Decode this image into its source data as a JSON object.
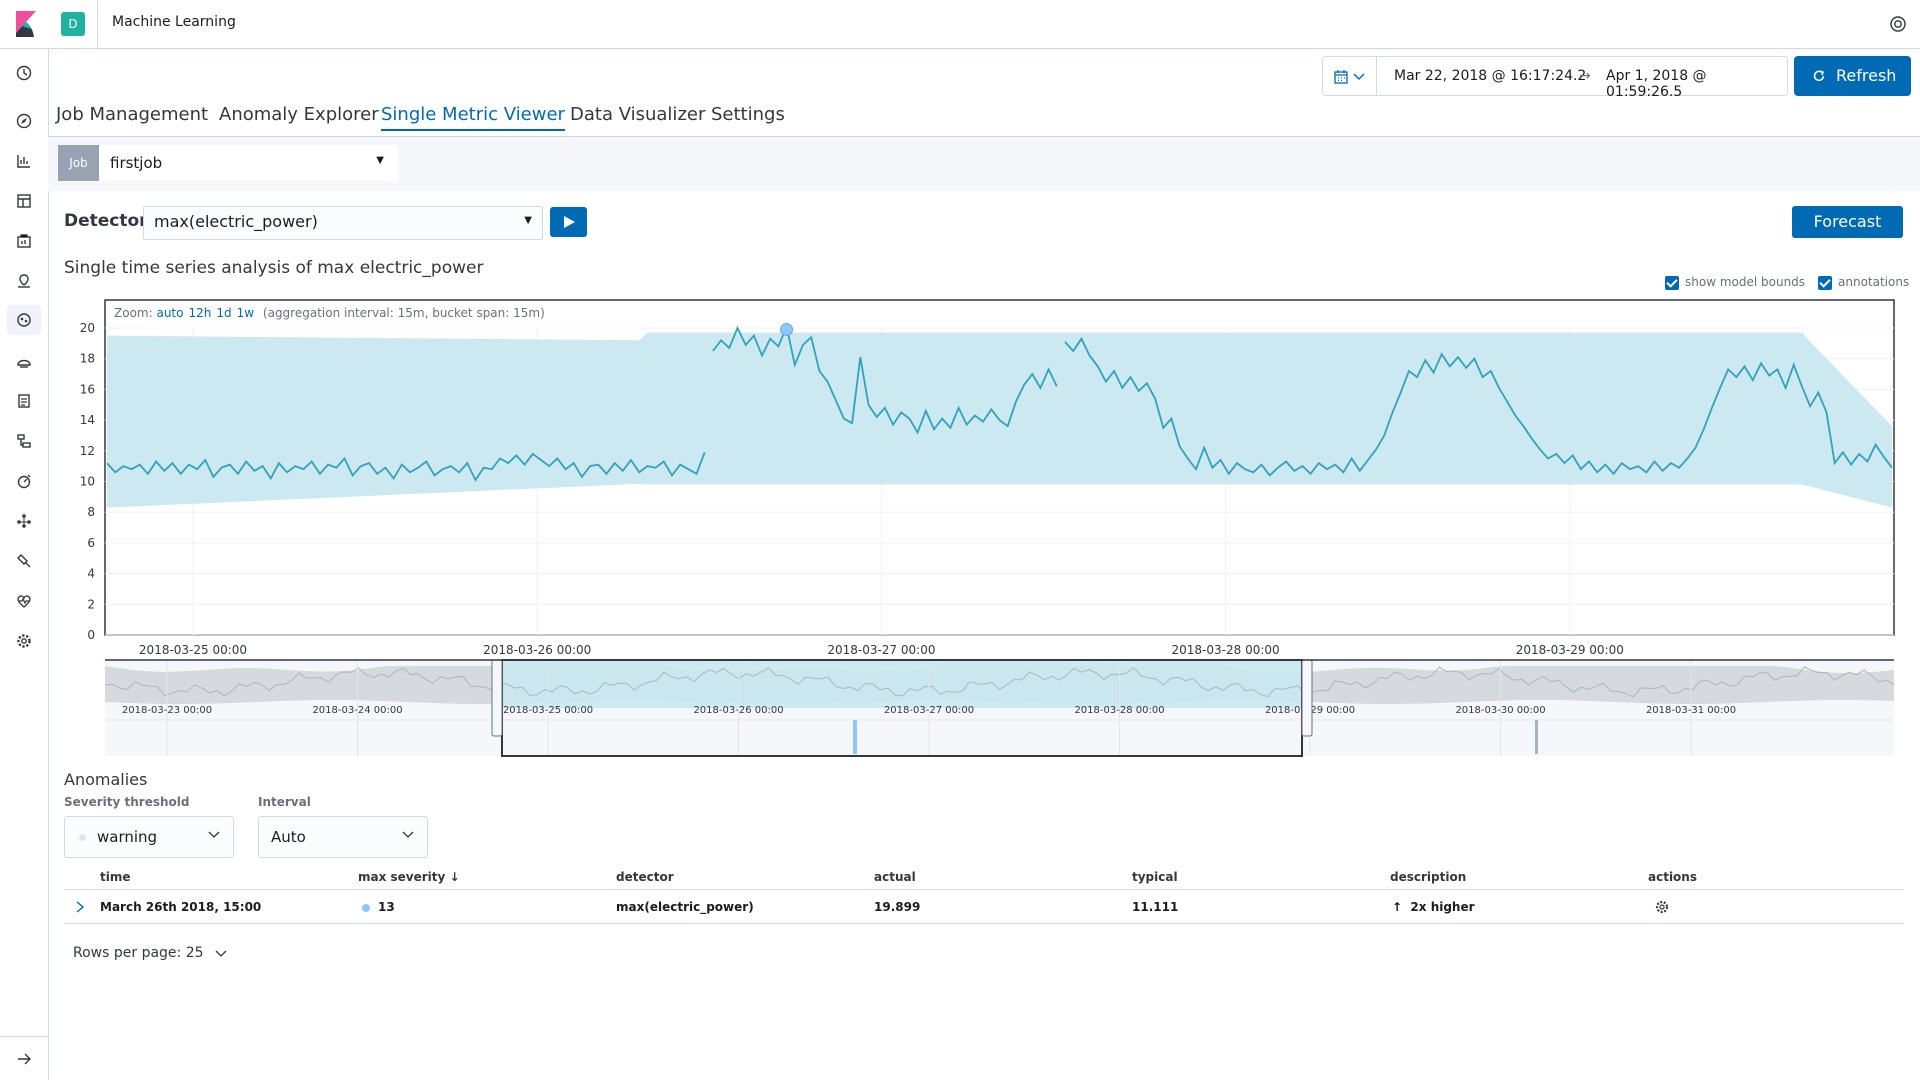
{
  "header": {
    "app_title": "Machine Learning",
    "space_initial": "D"
  },
  "time_picker": {
    "start": "Mar 22, 2018 @ 16:17:24.2",
    "arrow": "→",
    "end": "Apr 1, 2018 @ 01:59:26.5",
    "refresh_label": "Refresh"
  },
  "tabs": [
    "Job Management",
    "Anomaly Explorer",
    "Single Metric Viewer",
    "Data Visualizer",
    "Settings"
  ],
  "job": {
    "badge": "Job",
    "value": "firstjob"
  },
  "detector": {
    "label": "Detector:",
    "value": "max(electric_power)"
  },
  "forecast_label": "Forecast",
  "chart_title": "Single time series analysis of max electric_power",
  "toggles": {
    "model_bounds": "show model bounds",
    "annotations": "annotations"
  },
  "zoom": {
    "label": "Zoom:",
    "options": [
      "auto",
      "12h",
      "1d",
      "1w"
    ],
    "info": "(aggregation interval: 15m, bucket span: 15m)"
  },
  "chart_data": {
    "type": "line",
    "ylim": [
      0,
      20
    ],
    "yticks": [
      "0",
      "2",
      "4",
      "6",
      "8",
      "10",
      "12",
      "14",
      "16",
      "18",
      "20"
    ],
    "xticks": [
      "2018-03-25 00:00",
      "2018-03-26 00:00",
      "2018-03-27 00:00",
      "2018-03-28 00:00",
      "2018-03-29 00:00"
    ],
    "context_ticks": [
      "2018-03-23 00:00",
      "2018-03-24 00:00",
      "2018-03-25 00:00",
      "2018-03-26 00:00",
      "2018-03-27 00:00",
      "2018-03-28 00:00",
      "2018-03-29 00:00",
      "2018-03-30 00:00",
      "2018-03-31 00:00"
    ],
    "series": [
      {
        "values": [
          11.2,
          10.6,
          11,
          10.8,
          11.1,
          10.5,
          11.3,
          10.7,
          11.2,
          10.5,
          11.1,
          10.8,
          11.4,
          10.3,
          10.9,
          11.1,
          10.5,
          11.3,
          10.7,
          11,
          10.2,
          11.2,
          10.6,
          11,
          10.8,
          11.3,
          10.5,
          11.1,
          10.9,
          11.5,
          10.4,
          11,
          11.2,
          10.5,
          10.9,
          10.2,
          11.1,
          10.6,
          10.9,
          11.3,
          10.4,
          10.8,
          11,
          10.6,
          11.2,
          10.1,
          10.9,
          10.8,
          11.5,
          11.2,
          11.7,
          11.1,
          11.8,
          11.4,
          11,
          11.5,
          10.8,
          11.2,
          10.3,
          11,
          11.1,
          10.5,
          11.2,
          10.7,
          11.4,
          10.6,
          11,
          10.9,
          11.3,
          10.4,
          11.1,
          10.8,
          10.5,
          11.9,
          18.5,
          19.2,
          18.7,
          20,
          18.9,
          19.5,
          18.2,
          19.3,
          18.8,
          20.1,
          17.6,
          18.9,
          19.4,
          17.2,
          16.5,
          15.3,
          14.1,
          13.8,
          18.1,
          15,
          14.2,
          14.8,
          13.7,
          14.5,
          14.1,
          13.2,
          14.6,
          13.4,
          14.1,
          13.5,
          14.8,
          13.7,
          14.3,
          13.9,
          14.7,
          14,
          13.6,
          15.2,
          16.3,
          17,
          16.1,
          17.3,
          16.2,
          19.1,
          18.5,
          19.3,
          18.2,
          17.5,
          16.5,
          17.2,
          16.1,
          16.8,
          15.9,
          16.4,
          15.4,
          13.5,
          14.1,
          12.3,
          11.5,
          10.8,
          12.2,
          10.9,
          11.4,
          10.5,
          11.2,
          10.8,
          10.6,
          11.1,
          10.4,
          10.9,
          11.3,
          10.7,
          11,
          10.5,
          11.2,
          10.8,
          11.1,
          10.6,
          11.5,
          10.7,
          11.4,
          12.1,
          13,
          14.5,
          15.8,
          17.2,
          16.8,
          17.9,
          17.1,
          18.3,
          17.5,
          18.1,
          17.4,
          18,
          16.8,
          17.2,
          16.1,
          15.2,
          14.3,
          13.6,
          12.8,
          12.1,
          11.5,
          11.8,
          11.2,
          11.7,
          10.8,
          11.3,
          10.6,
          11.1,
          10.5,
          11.2,
          10.8,
          11,
          10.6,
          11.3,
          10.7,
          11.2,
          10.9,
          11.5,
          12.2,
          13.4,
          14.8,
          16.1,
          17.3,
          16.8,
          17.5,
          16.6,
          17.7,
          16.9,
          17.3,
          16.1,
          17.6,
          16.2,
          14.9,
          15.8,
          14.5,
          11.2,
          11.9,
          11.1,
          11.8,
          11.3,
          12.4,
          11.6,
          10.9
        ],
        "breaks": [
          74,
          117
        ]
      }
    ],
    "anomaly_marker": {
      "x_index": 83,
      "value": 19.9
    }
  },
  "anomalies": {
    "title": "Anomalies",
    "severity_label": "Severity threshold",
    "severity_value": "warning",
    "interval_label": "Interval",
    "interval_value": "Auto",
    "columns": [
      "time",
      "max severity",
      "detector",
      "actual",
      "typical",
      "description",
      "actions"
    ],
    "rows": [
      {
        "time": "March 26th 2018, 15:00",
        "severity": "13",
        "detector": "max(electric_power)",
        "actual": "19.899",
        "typical": "11.111",
        "description": "2x higher"
      }
    ],
    "rows_per_page": "Rows per page: 25"
  },
  "colors": {
    "accent": "#006bb4",
    "series": "#32a2bb",
    "band": "#c9e7ef"
  }
}
